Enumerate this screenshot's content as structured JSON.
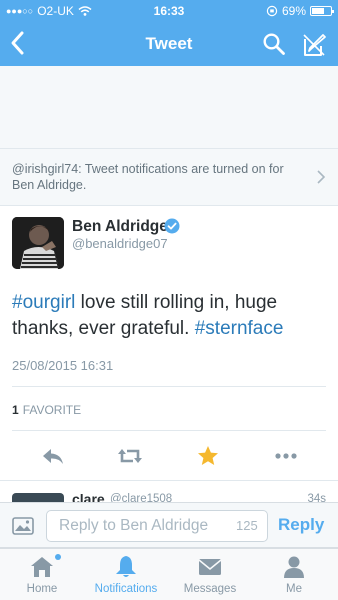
{
  "status_bar": {
    "signal_dots": "●●●○○",
    "carrier": "O2-UK",
    "time": "16:33",
    "battery_percent": "69%",
    "battery_level": 0.69
  },
  "nav": {
    "title": "Tweet",
    "back_icon": "chevron-left-icon",
    "search_icon": "search-icon",
    "compose_icon": "compose-icon"
  },
  "notice": {
    "text": "@irishgirl74: Tweet notifications are turned on for Ben Aldridge."
  },
  "tweet": {
    "author_name": "Ben Aldridge",
    "author_handle": "@benaldridge07",
    "verified": true,
    "text_parts": [
      {
        "text": "#ourgirl",
        "hashtag": true
      },
      {
        "text": " love still rolling in, huge thanks, ever grateful. ",
        "hashtag": false
      },
      {
        "text": "#sternface",
        "hashtag": true
      }
    ],
    "timestamp": "25/08/2015 16:31",
    "favorites_count": "1",
    "favorites_label": "FAVORITE"
  },
  "actions": {
    "reply_icon": "reply-icon",
    "retweet_icon": "retweet-icon",
    "favorite_icon": "star-icon",
    "more_icon": "more-icon"
  },
  "next_reply": {
    "name": "clare",
    "handle": "@clare1508",
    "time": "34s"
  },
  "reply_bar": {
    "placeholder": "Reply to Ben Aldridge",
    "char_count": "125",
    "reply_label": "Reply"
  },
  "tabs": [
    {
      "label": "Home",
      "icon": "home-icon"
    },
    {
      "label": "Notifications",
      "icon": "bell-icon",
      "active": true
    },
    {
      "label": "Messages",
      "icon": "envelope-icon"
    },
    {
      "label": "Me",
      "icon": "person-icon"
    }
  ],
  "colors": {
    "brand": "#55acee",
    "hashtag": "#2b7bb9",
    "favorite_active": "#f5b82e"
  }
}
